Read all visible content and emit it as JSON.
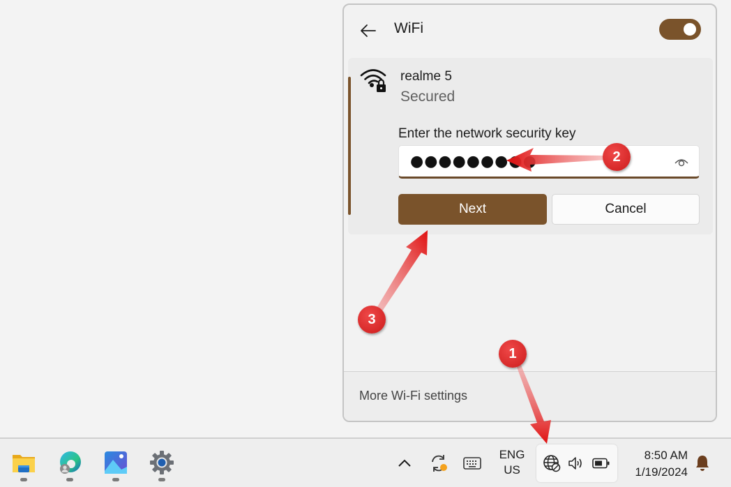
{
  "flyout": {
    "title": "WiFi",
    "wifi_enabled": true,
    "network": {
      "name": "realme 5",
      "status": "Secured",
      "key_label": "Enter the network security key",
      "key_value_masked": "●●●●●●●●●",
      "next_label": "Next",
      "cancel_label": "Cancel"
    },
    "footer_link": "More Wi-Fi settings"
  },
  "taskbar": {
    "pinned_apps": [
      {
        "name": "File Explorer",
        "icon": "folder-icon"
      },
      {
        "name": "Microsoft Edge",
        "icon": "edge-icon"
      },
      {
        "name": "Photos",
        "icon": "photos-icon"
      },
      {
        "name": "Settings",
        "icon": "gear-icon"
      }
    ],
    "tray": {
      "overflow_icon": "chevron-up-icon",
      "sync_icon": "sync-icon",
      "keyboard_icon": "keyboard-icon",
      "language_line1": "ENG",
      "language_line2": "US",
      "network_icon": "globe-no-internet-icon",
      "volume_icon": "speaker-icon",
      "battery_icon": "battery-icon"
    },
    "clock": {
      "time": "8:50 AM",
      "date": "1/19/2024"
    },
    "notification_icon": "bell-icon"
  },
  "annotations": [
    {
      "number": "1",
      "target": "network tray icon"
    },
    {
      "number": "2",
      "target": "security key field"
    },
    {
      "number": "3",
      "target": "Next button"
    }
  ],
  "colors": {
    "accent": "#7a532b",
    "callout": "#d42424",
    "background": "#f3f3f3"
  }
}
